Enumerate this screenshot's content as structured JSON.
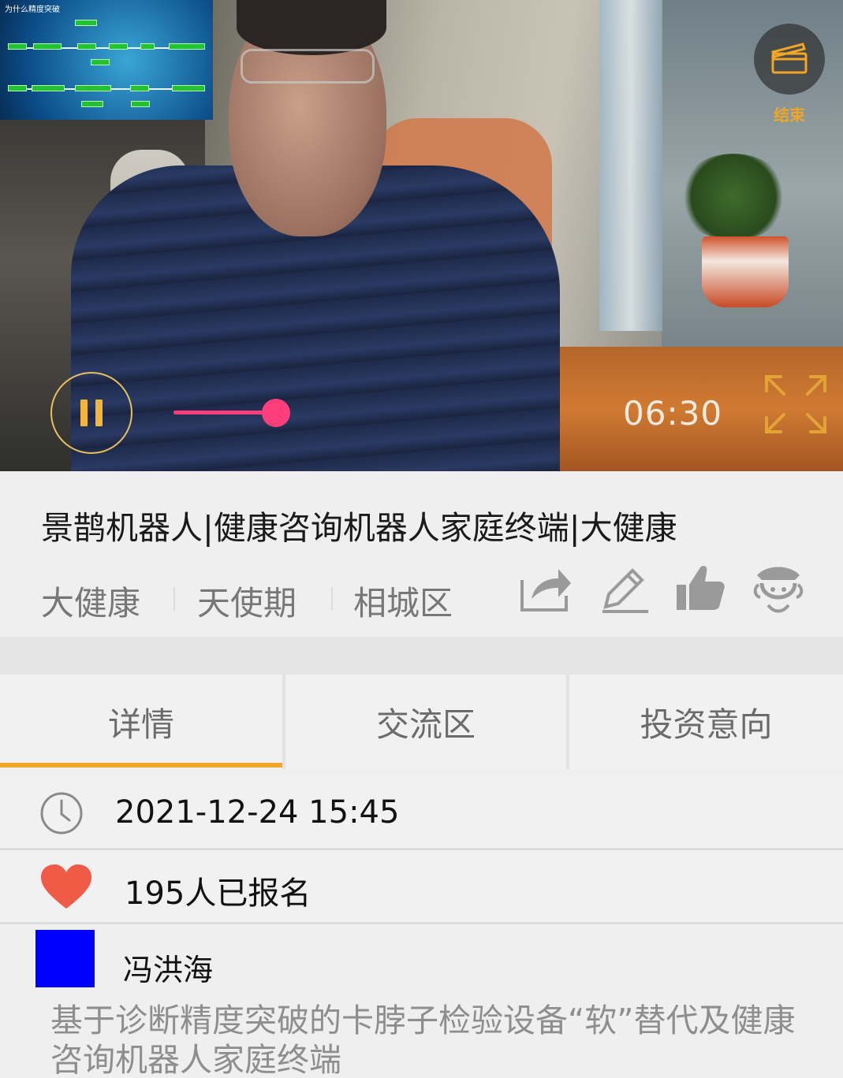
{
  "video": {
    "pip_title": "为什么精度突破",
    "end_label": "结束",
    "time": "06:30",
    "progress": 0.3
  },
  "info": {
    "title": "景鹊机器人|健康咨询机器人家庭终端|大健康",
    "tags": [
      "大健康",
      "天使期",
      "相城区"
    ],
    "actions": [
      "share-icon",
      "edit-icon",
      "thumbs-up-icon",
      "service-agent-icon"
    ]
  },
  "tabs": [
    {
      "label": "详情",
      "active": true
    },
    {
      "label": "交流区",
      "active": false
    },
    {
      "label": "投资意向",
      "active": false
    }
  ],
  "details": {
    "datetime": "2021-12-24 15:45",
    "signups": "195人已报名",
    "author": "冯洪海",
    "description": "基于诊断精度突破的卡脖子检验设备“软”替代及健康咨询机器人家庭终端"
  },
  "colors": {
    "accent": "#f3a72a",
    "progress": "#ff3e7b",
    "heart": "#f15a47",
    "avatar": "#0000ff"
  }
}
